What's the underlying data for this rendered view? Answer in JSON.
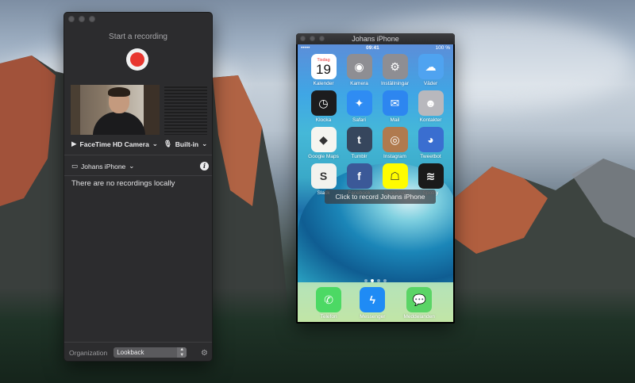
{
  "recorder": {
    "title": "Start a recording",
    "camera_label": "FaceTime HD Camera",
    "mic_label": "Built-in",
    "device_label": "Johans iPhone",
    "empty_message": "There are no recordings locally",
    "organization_label": "Organization",
    "organization_value": "Lookback",
    "record_color": "#e8362f"
  },
  "iphone": {
    "window_title": "Johans iPhone",
    "status_time": "09:41",
    "status_carrier": "•••••",
    "status_battery": "100 %",
    "overlay_text": "Click to record Johans iPhone",
    "calendar_day": "Tisdag",
    "calendar_date": "19",
    "apps": [
      {
        "label": "Kalender",
        "icon": "calendar-icon",
        "color": "#ffffff",
        "glyph": ""
      },
      {
        "label": "Kamera",
        "icon": "camera-icon",
        "color": "#8e8e93",
        "glyph": "◉"
      },
      {
        "label": "Inställningar",
        "icon": "settings-icon",
        "color": "#8e8e93",
        "glyph": "⚙"
      },
      {
        "label": "Väder",
        "icon": "weather-icon",
        "color": "#4fa3f0",
        "glyph": "☁"
      },
      {
        "label": "Klocka",
        "icon": "clock-icon",
        "color": "#1c1c1e",
        "glyph": "◷"
      },
      {
        "label": "Safari",
        "icon": "safari-icon",
        "color": "#2f8cf3",
        "glyph": "✦"
      },
      {
        "label": "Mail",
        "icon": "mail-icon",
        "color": "#2d86f0",
        "glyph": "✉"
      },
      {
        "label": "Kontakter",
        "icon": "contacts-icon",
        "color": "#b8b8bd",
        "glyph": "☻"
      },
      {
        "label": "Google Maps",
        "icon": "google-maps-icon",
        "color": "#f5f5f0",
        "glyph": "◆"
      },
      {
        "label": "Tumblr",
        "icon": "tumblr-icon",
        "color": "#36465d",
        "glyph": "t"
      },
      {
        "label": "Instagram",
        "icon": "instagram-icon",
        "color": "#b07a4e",
        "glyph": "◎"
      },
      {
        "label": "Tweetbot",
        "icon": "tweetbot-icon",
        "color": "#3a6ed0",
        "glyph": "◕"
      },
      {
        "label": "Slack",
        "icon": "slack-icon",
        "color": "#f2f2ee",
        "glyph": "S"
      },
      {
        "label": "Facebook",
        "icon": "facebook-icon",
        "color": "#3b5998",
        "glyph": "f"
      },
      {
        "label": "Snapchat",
        "icon": "snapchat-icon",
        "color": "#fffc00",
        "glyph": "☖"
      },
      {
        "label": "Spotify",
        "icon": "spotify-icon",
        "color": "#1a1a1a",
        "glyph": "≋"
      }
    ],
    "dock": [
      {
        "label": "Telefon",
        "icon": "phone-icon",
        "color": "#4cd964",
        "glyph": "✆"
      },
      {
        "label": "Messenger",
        "icon": "messenger-icon",
        "color": "#1f8bf5",
        "glyph": "ϟ"
      },
      {
        "label": "Meddelanden",
        "icon": "messages-icon",
        "color": "#5ad466",
        "glyph": "💬"
      }
    ]
  }
}
